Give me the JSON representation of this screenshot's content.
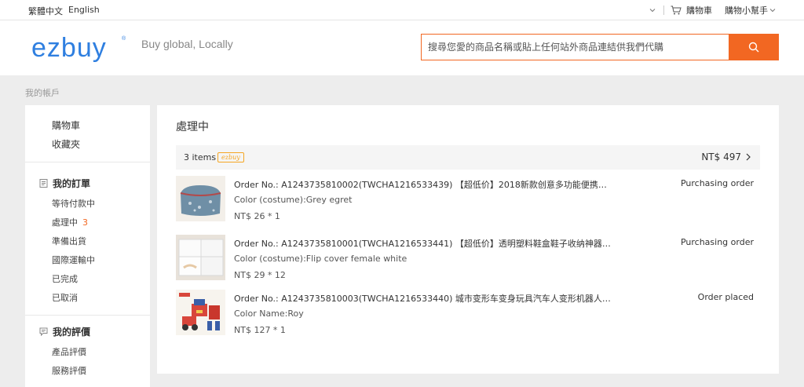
{
  "topbar": {
    "lang_zh": "繁體中文",
    "lang_en": "English",
    "cart_label": "購物車",
    "helper_label": "購物小幫手"
  },
  "header": {
    "logo_text": "ezbuy",
    "slogan": "Buy global, Locally",
    "search_placeholder": "搜尋您愛的商品名稱或貼上任何站外商品連結供我們代購",
    "accent_color": "#f26722",
    "logo_color": "#2f7fe0"
  },
  "breadcrumb": "我的帳戶",
  "sidebar": {
    "top_links": [
      "購物車",
      "收藏夾"
    ],
    "orders_heading": "我的訂單",
    "order_links": [
      {
        "label": "等待付款中",
        "count": ""
      },
      {
        "label": "處理中",
        "count": "3"
      },
      {
        "label": "準備出貨",
        "count": ""
      },
      {
        "label": "國際運輸中",
        "count": ""
      },
      {
        "label": "已完成",
        "count": ""
      },
      {
        "label": "已取消",
        "count": ""
      }
    ],
    "reviews_heading": "我的評價",
    "review_links": [
      "產品評價",
      "服務評價"
    ]
  },
  "main": {
    "title": "處理中",
    "items_count": "3 items",
    "source_tag": "ezbuy",
    "total": "NT$ 497",
    "orders": [
      {
        "title": "Order No.: A1243735810002(TWCHA1216533439) 【超低价】2018新款创意多功能便携化妆包...",
        "attr": "Color (costume):Grey egret",
        "price": "NT$ 26 * 1",
        "status": "Purchasing order",
        "thumb_icon": "bag-thumbnail"
      },
      {
        "title": "Order No.: A1243735810001(TWCHA1216533441) 【超低价】透明塑料鞋盒鞋子收纳神器鞋盒...",
        "attr": "Color (costume):Flip cover female white",
        "price": "NT$ 29 * 12",
        "status": "Purchasing order",
        "thumb_icon": "shoebox-thumbnail"
      },
      {
        "title": "Order No.: A1243735810003(TWCHA1216533440) 城市变形车变身玩具汽车人变形机器人套装...",
        "attr": "Color Name:Roy",
        "price": "NT$ 127 * 1",
        "status": "Order placed",
        "thumb_icon": "robot-toy-thumbnail"
      }
    ]
  }
}
